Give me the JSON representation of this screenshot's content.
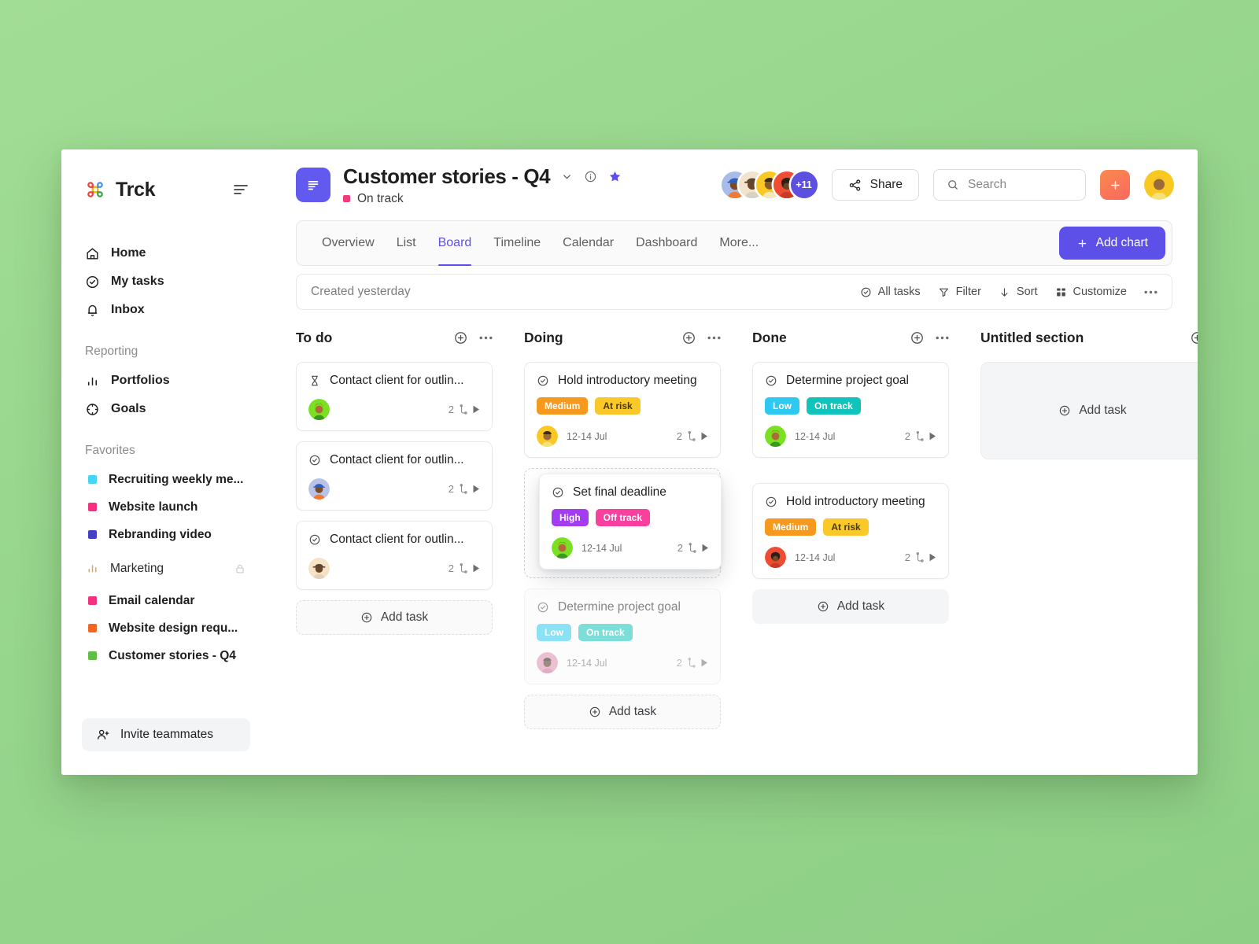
{
  "app": {
    "brand": "Trck",
    "logo_icon": "command-logo-icon",
    "menu_icon": "hamburger-icon"
  },
  "sidebar": {
    "nav": [
      {
        "label": "Home",
        "icon": "home-icon"
      },
      {
        "label": "My tasks",
        "icon": "check-circle-icon"
      },
      {
        "label": "Inbox",
        "icon": "bell-icon"
      }
    ],
    "reporting_label": "Reporting",
    "reporting": [
      {
        "label": "Portfolios",
        "icon": "bar-chart-icon"
      },
      {
        "label": "Goals",
        "icon": "target-icon"
      }
    ],
    "favorites_label": "Favorites",
    "favorites": [
      {
        "label": "Recruiting weekly me...",
        "color": "#44d7f5",
        "icon": "color-square"
      },
      {
        "label": "Website launch",
        "color": "#f5317f",
        "icon": "color-square"
      },
      {
        "label": "Rebranding video",
        "color": "#4740c4",
        "icon": "color-square"
      },
      {
        "label": "Marketing",
        "color": "#f6a23c",
        "icon": "bar-chart-icon",
        "locked": true,
        "lock_icon": "lock-icon"
      },
      {
        "label": "Email calendar",
        "color": "#f5317f",
        "icon": "color-square"
      },
      {
        "label": "Website design requ...",
        "color": "#f26522",
        "icon": "color-square"
      },
      {
        "label": "Customer stories - Q4",
        "color": "#5fbf45",
        "icon": "color-square"
      }
    ],
    "invite_label": "Invite teammates",
    "invite_icon": "person-add-icon"
  },
  "header": {
    "project_icon": "board-list-icon",
    "title": "Customer stories - Q4",
    "chevron_icon": "chevron-down-icon",
    "info_icon": "info-circle-icon",
    "star_icon": "star-filled-icon",
    "status": "On track",
    "status_color": "#f2397c",
    "members_overflow": "+11",
    "share_label": "Share",
    "share_icon": "share-icon",
    "search_placeholder": "Search",
    "search_value": "",
    "search_icon": "search-icon",
    "add_icon": "plus-icon",
    "user_avatar": "user-avatar"
  },
  "tabs": {
    "items": [
      {
        "label": "Overview",
        "active": false
      },
      {
        "label": "List",
        "active": false
      },
      {
        "label": "Board",
        "active": true
      },
      {
        "label": "Timeline",
        "active": false
      },
      {
        "label": "Calendar",
        "active": false
      },
      {
        "label": "Dashboard",
        "active": false
      },
      {
        "label": "More...",
        "active": false
      }
    ],
    "add_chart_label": "Add chart",
    "add_chart_icon": "plus-icon",
    "accent_color": "#5c50e8"
  },
  "toolbar": {
    "created_text": "Created yesterday",
    "items": [
      {
        "label": "All tasks",
        "icon": "check-circle-icon"
      },
      {
        "label": "Filter",
        "icon": "filter-icon"
      },
      {
        "label": "Sort",
        "icon": "arrow-down-icon"
      },
      {
        "label": "Customize",
        "icon": "grid-icon"
      }
    ],
    "overflow_icon": "ellipsis-icon"
  },
  "board": {
    "add_icon": "plus-circle-icon",
    "overflow_icon": "ellipsis-icon",
    "add_task_label": "Add task",
    "columns": [
      {
        "title": "To do",
        "has_actions": true,
        "cards": [
          {
            "title": "Contact client for outlin...",
            "status_icon": "hourglass-icon",
            "tags": [],
            "date": "",
            "subtask_count": "2",
            "subtask_icon": "subtask-icon",
            "expand_icon": "play-icon",
            "avatar": "avatar-green"
          },
          {
            "title": "Contact client for outlin...",
            "status_icon": "check-circle-icon",
            "tags": [],
            "date": "",
            "subtask_count": "2",
            "subtask_icon": "subtask-icon",
            "expand_icon": "play-icon",
            "avatar": "avatar-periwinkle"
          },
          {
            "title": "Contact client for outlin...",
            "status_icon": "check-circle-icon",
            "tags": [],
            "date": "",
            "subtask_count": "2",
            "subtask_icon": "subtask-icon",
            "expand_icon": "play-icon",
            "avatar": "avatar-cream"
          }
        ],
        "footer_add": "dashed"
      },
      {
        "title": "Doing",
        "has_actions": true,
        "cards": [
          {
            "title": "Hold introductory meeting",
            "status_icon": "check-circle-icon",
            "tags": [
              {
                "label": "Medium",
                "color": "#f59a1e"
              },
              {
                "label": "At risk",
                "color": "#fac828",
                "text_color": "#4a3b05"
              }
            ],
            "date": "12-14 Jul",
            "subtask_count": "2",
            "subtask_icon": "subtask-icon",
            "expand_icon": "play-icon",
            "avatar": "avatar-yellow"
          },
          {
            "title": "Set final deadline",
            "status_icon": "check-circle-icon",
            "dragging": true,
            "tags": [
              {
                "label": "High",
                "color": "#a43cf2"
              },
              {
                "label": "Off track",
                "color": "#f9409e"
              }
            ],
            "date": "12-14 Jul",
            "subtask_count": "2",
            "subtask_icon": "subtask-icon",
            "expand_icon": "play-icon",
            "avatar": "avatar-green"
          },
          {
            "title": "Determine project goal",
            "status_icon": "check-circle-icon",
            "ghosted": true,
            "tags": [
              {
                "label": "Low",
                "color": "#2ec9f0"
              },
              {
                "label": "On track",
                "color": "#11c4bb"
              }
            ],
            "date": "12-14 Jul",
            "subtask_count": "2",
            "subtask_icon": "subtask-icon",
            "expand_icon": "play-icon",
            "avatar": "avatar-pink"
          }
        ],
        "footer_add": "dashed"
      },
      {
        "title": "Done",
        "has_actions": true,
        "cards": [
          {
            "title": "Determine project goal",
            "status_icon": "check-circle-icon",
            "tags": [
              {
                "label": "Low",
                "color": "#2ec9f0"
              },
              {
                "label": "On track",
                "color": "#11c4bb"
              }
            ],
            "date": "12-14 Jul",
            "subtask_count": "2",
            "subtask_icon": "subtask-icon",
            "expand_icon": "play-icon",
            "avatar": "avatar-green"
          },
          {
            "title": "Hold introductory meeting",
            "status_icon": "check-circle-icon",
            "tags": [
              {
                "label": "Medium",
                "color": "#f59a1e"
              },
              {
                "label": "At risk",
                "color": "#fac828",
                "text_color": "#4a3b05"
              }
            ],
            "date": "12-14 Jul",
            "subtask_count": "2",
            "subtask_icon": "subtask-icon",
            "expand_icon": "play-icon",
            "avatar": "avatar-red"
          }
        ],
        "footer_add": "solid"
      },
      {
        "title": "Untitled section",
        "has_actions": false,
        "cards": [],
        "empty_drop_label": "Add task",
        "footer_add": "none"
      }
    ]
  }
}
